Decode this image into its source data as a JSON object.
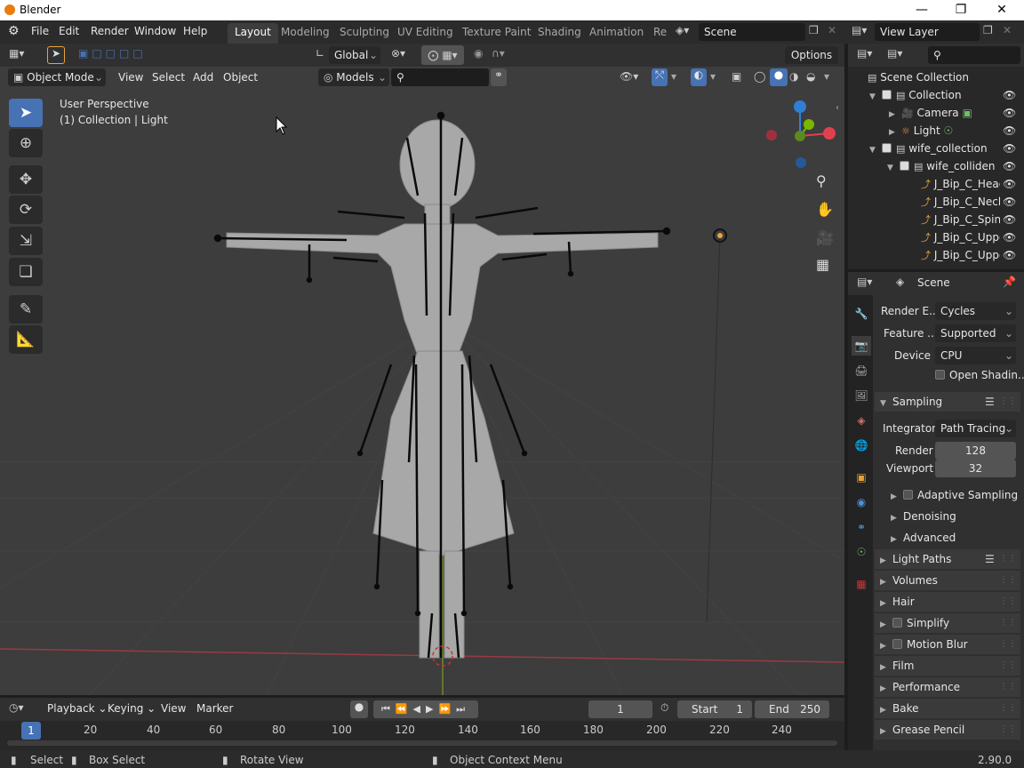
{
  "window": {
    "title": "Blender"
  },
  "menu": [
    "File",
    "Edit",
    "Render",
    "Window",
    "Help"
  ],
  "workspaces": [
    "Layout",
    "Modeling",
    "Sculpting",
    "UV Editing",
    "Texture Paint",
    "Shading",
    "Animation",
    "Re"
  ],
  "scene_field": "Scene",
  "view_layer_field": "View Layer",
  "tool_header": {
    "transform_orientation": "Global",
    "options_label": "Options"
  },
  "viewport_header": {
    "mode": "Object Mode",
    "view": "View",
    "select": "Select",
    "add": "Add",
    "object": "Object",
    "filter": "Models"
  },
  "viewport": {
    "perspective": "User Perspective",
    "context": "(1) Collection | Light"
  },
  "outliner": {
    "rows": [
      {
        "label": "Scene Collection"
      },
      {
        "label": "Collection"
      },
      {
        "label": "Camera"
      },
      {
        "label": "Light"
      },
      {
        "label": "wife_collection"
      },
      {
        "label": "wife_colliden"
      },
      {
        "label": "J_Bip_C_Heac"
      },
      {
        "label": "J_Bip_C_Neck"
      },
      {
        "label": "J_Bip_C_Spine"
      },
      {
        "label": "J_Bip_C_Uppe"
      },
      {
        "label": "J_Bip_C_Uppe"
      }
    ]
  },
  "properties": {
    "header": "Scene",
    "render_engine_label": "Render E...",
    "render_engine": "Cycles",
    "feature_label": "Feature ...",
    "feature": "Supported",
    "device_label": "Device",
    "device": "CPU",
    "osl_label": "Open Shadin...",
    "sampling": "Sampling",
    "integrator_label": "Integrator",
    "integrator": "Path Tracing",
    "render_label": "Render",
    "render_samples": "128",
    "viewport_label": "Viewport",
    "viewport_samples": "32",
    "adaptive": "Adaptive Sampling",
    "denoising": "Denoising",
    "advanced": "Advanced",
    "panels": [
      "Light Paths",
      "Volumes",
      "Hair",
      "Simplify",
      "Motion Blur",
      "Film",
      "Performance",
      "Bake",
      "Grease Pencil"
    ]
  },
  "timeline": {
    "playback": "Playback",
    "keying": "Keying",
    "view": "View",
    "marker": "Marker",
    "current_frame": "1",
    "start_label": "Start",
    "start": "1",
    "end_label": "End",
    "end": "250",
    "ruler_current": "1",
    "ruler": [
      "20",
      "40",
      "60",
      "80",
      "100",
      "120",
      "140",
      "160",
      "180",
      "200",
      "220",
      "240"
    ]
  },
  "status": {
    "select": "Select",
    "box_select": "Box Select",
    "rotate": "Rotate View",
    "context_menu": "Object Context Menu",
    "version": "2.90.0"
  },
  "colors": {
    "accent": "#4772b3",
    "x_axis": "#e04050",
    "y_axis": "#7ab800",
    "z_axis": "#2f7fd4"
  }
}
